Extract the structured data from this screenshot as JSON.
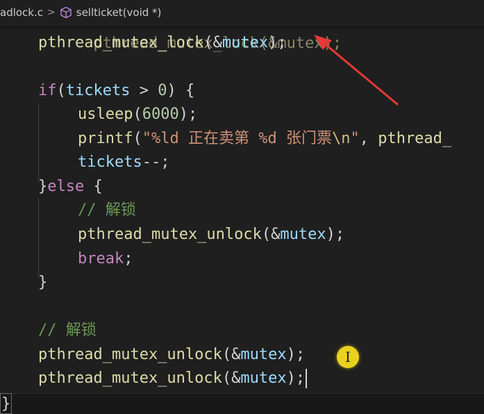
{
  "breadcrumb": {
    "file": "adlock.c",
    "separator": ">",
    "symbol": "sellticket(void *)"
  },
  "code": {
    "partial_top": "pthread_mutex_lock(&mutex);",
    "line1": {
      "fn": "pthread_mutex_lock",
      "p1": "(",
      "amp": "&",
      "var": "mutex",
      "p2": ");"
    },
    "line3": {
      "kw": "if",
      "p1": "(",
      "var": "tickets",
      "op": " > ",
      "num": "0",
      "p2": ") {"
    },
    "line4": {
      "fn": "usleep",
      "p1": "(",
      "num": "6000",
      "p2": ");"
    },
    "line5": {
      "fn": "printf",
      "p1": "(",
      "str1": "\"%ld 正在卖第 %d 张门票",
      "esc": "\\n",
      "str2": "\"",
      "p2": ", ",
      "tail": "pthread_"
    },
    "line6": {
      "var": "tickets",
      "p": "--;"
    },
    "line7": {
      "p1": "}",
      "kw": "else",
      "p2": " {"
    },
    "line8": {
      "cmt": "// 解锁"
    },
    "line9": {
      "fn": "pthread_mutex_unlock",
      "p1": "(",
      "amp": "&",
      "var": "mutex",
      "p2": ");"
    },
    "line10": {
      "kw": "break",
      "p": ";"
    },
    "line11": {
      "p": "}"
    },
    "line13": {
      "cmt": "// 解锁"
    },
    "line14": {
      "fn": "pthread_mutex_unlock",
      "p1": "(",
      "amp": "&",
      "var": "mutex",
      "p2": ");"
    },
    "line15": {
      "fn": "pthread_mutex_unlock",
      "p1": "(",
      "amp": "&",
      "var": "mutex",
      "p2": ");"
    },
    "closing_brace": "}"
  },
  "cursor_indicator": {
    "glyph": "I",
    "color": "#e8d21d"
  },
  "colors": {
    "background": "#1f1f1f",
    "keyword": "#c586c0",
    "function": "#dcdcaa",
    "variable": "#9cdcfe",
    "number": "#b5cea8",
    "string": "#ce9178",
    "comment": "#6a9955",
    "annotation_arrow": "#e53935"
  },
  "icons": {
    "symbol_icon": "method-cube-icon",
    "annotation": "red-arrow-icon"
  }
}
